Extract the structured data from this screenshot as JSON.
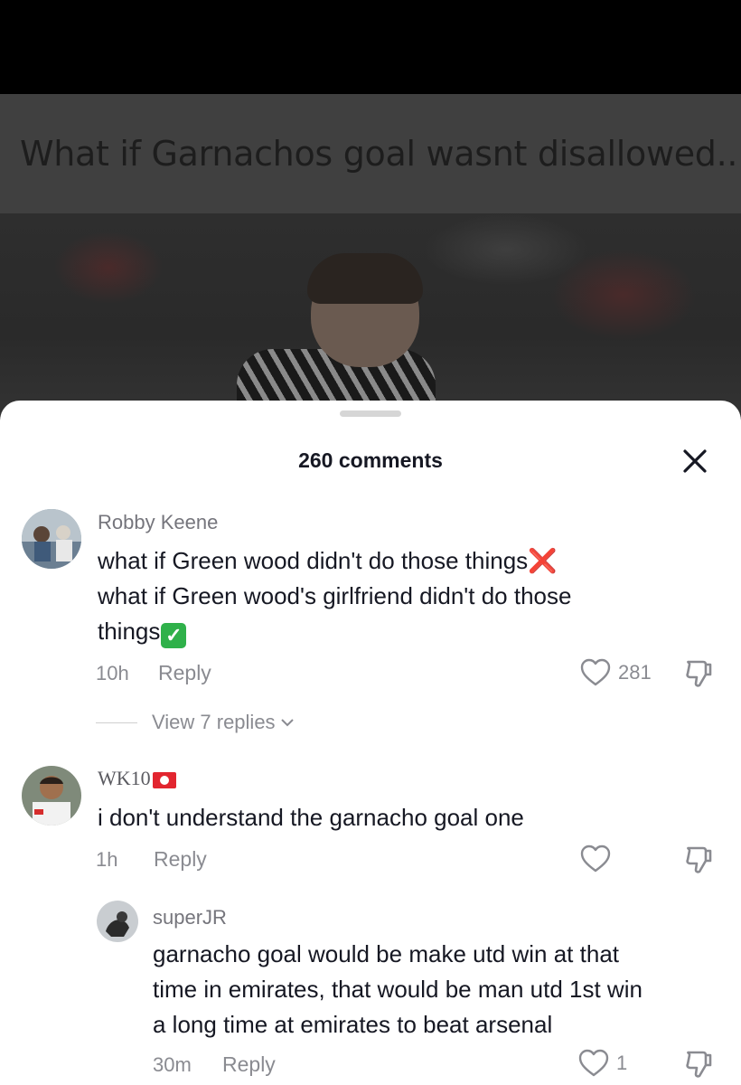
{
  "video": {
    "caption": "What if Garnachos goal wasnt disallowed..."
  },
  "comments_sheet": {
    "title": "260 comments",
    "close_icon": "close-icon",
    "colors": {
      "text": "#161823",
      "muted": "#8a8b91",
      "x_emoji": "#e0202a",
      "check_emoji": "#2fb14a"
    }
  },
  "comments": [
    {
      "username": "Robby Keene",
      "lines": [
        "what if Green wood didn't do those things",
        "what if Green wood's girlfriend didn't do those",
        "things"
      ],
      "emoji_1": "❌",
      "emoji_2": "✓",
      "time": "10h",
      "reply_label": "Reply",
      "likes": "281",
      "view_replies": "View 7 replies"
    },
    {
      "username": "WK10",
      "text": "i don't understand the garnacho goal one",
      "time": "1h",
      "reply_label": "Reply"
    },
    {
      "username": "superJR",
      "lines": [
        "garnacho goal would be make utd win at that",
        "time in emirates, that would be man utd 1st win",
        "a long time at emirates to beat arsenal"
      ],
      "time": "30m",
      "reply_label": "Reply",
      "likes": "1"
    }
  ]
}
